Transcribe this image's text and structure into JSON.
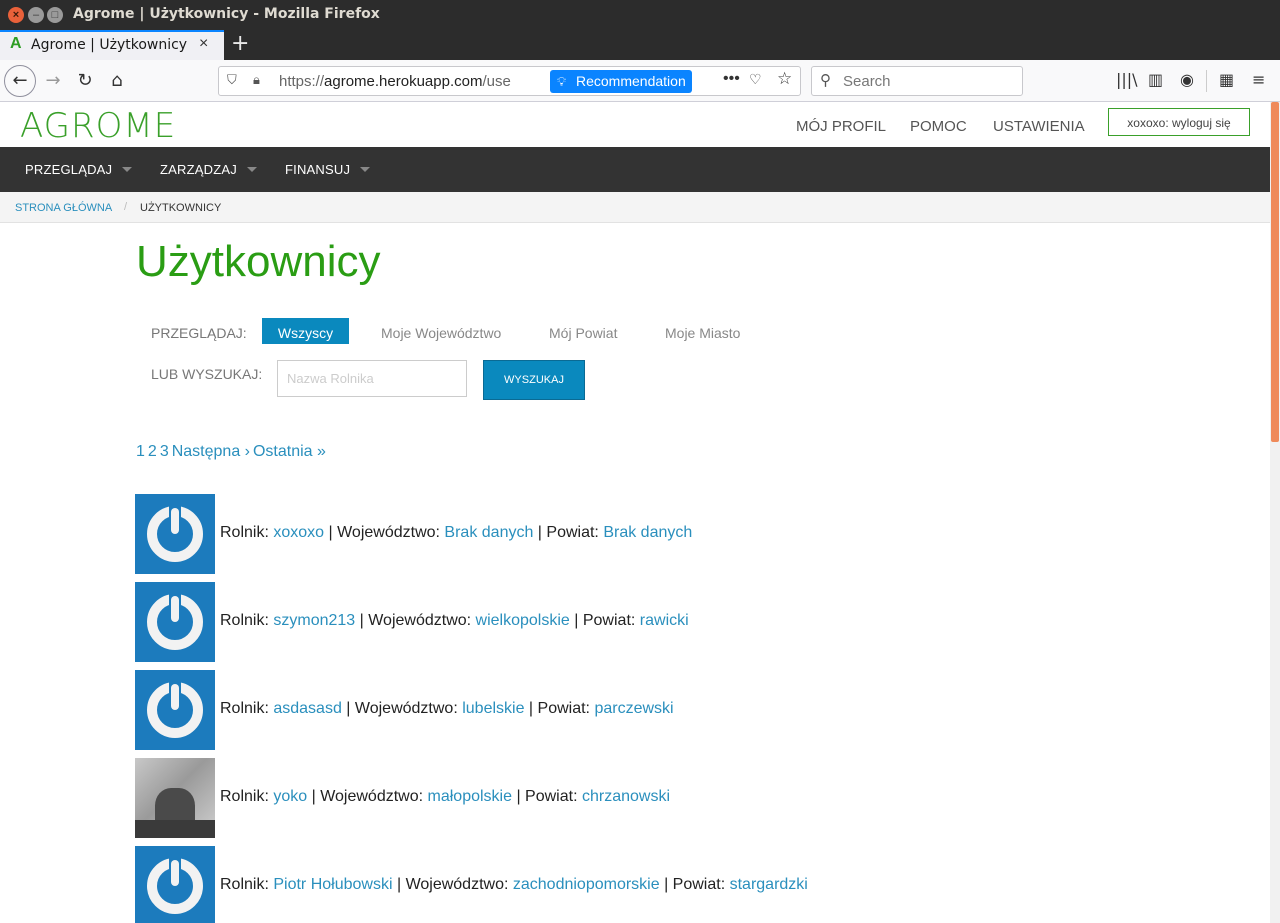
{
  "window": {
    "title": "Agrome | Użytkownicy - Mozilla Firefox",
    "controls": {
      "close": "×",
      "minimize": "–",
      "maximize": "□"
    }
  },
  "tab": {
    "favicon": "A",
    "title": "Agrome | Użytkownicy",
    "close": "×",
    "new_tab": "+"
  },
  "navbar": {
    "back": "←",
    "forward": "→",
    "reload": "↻",
    "home": "⌂",
    "url_prefix": "https://",
    "url_host": "agrome.herokuapp.com",
    "url_path": "/use",
    "recommendation": "Recommendation",
    "page_actions": "•••",
    "pocket": "♡",
    "bookmark_star": "☆",
    "search_placeholder": "Search",
    "library": "|||\\",
    "sidebar": "▥",
    "account": "◉",
    "extensions": "▦",
    "menu": "≡"
  },
  "site": {
    "logo": "AGROME",
    "top_links": {
      "profile": "MÓJ PROFIL",
      "help": "POMOC",
      "settings": "USTAWIENIA",
      "logout": "xoxoxo: wyloguj się"
    },
    "main_nav": [
      "PRZEGLĄDAJ",
      "ZARZĄDZAJ",
      "FINANSUJ"
    ],
    "breadcrumbs": {
      "home": "STRONA GŁÓWNA",
      "separator": "/",
      "current": "UŻYTKOWNICY"
    },
    "page_title": "Użytkownicy",
    "filter": {
      "label": "PRZEGLĄDAJ:",
      "tabs": [
        "Wszyscy",
        "Moje Województwo",
        "Mój Powiat",
        "Moje Miasto"
      ],
      "active_index": 0
    },
    "search": {
      "label": "LUB WYSZUKAJ:",
      "placeholder": "Nazwa Rolnika",
      "button": "WYSZUKAJ"
    },
    "pagination": [
      "1",
      "2",
      "3",
      "Następna ›",
      "Ostatnia »"
    ],
    "row_labels": {
      "farmer": "Rolnik: ",
      "voivodeship": " | Województwo: ",
      "county": " | Powiat: "
    },
    "users": [
      {
        "name": "xoxoxo",
        "voivodeship": "Brak danych",
        "county": "Brak danych",
        "avatar": "power-icon"
      },
      {
        "name": "szymon213",
        "voivodeship": "wielkopolskie",
        "county": "rawicki",
        "avatar": "power-icon"
      },
      {
        "name": "asdasasd",
        "voivodeship": "lubelskie",
        "county": "parczewski",
        "avatar": "power-icon"
      },
      {
        "name": "yoko",
        "voivodeship": "małopolskie",
        "county": "chrzanowski",
        "avatar": "photo"
      },
      {
        "name": "Piotr Hołubowski",
        "voivodeship": "zachodniopomorskie",
        "county": "stargardzki",
        "avatar": "power-icon"
      }
    ]
  },
  "colors": {
    "brand_green": "#2a9d14",
    "link_blue": "#2a8fbd",
    "button_blue": "#0a89be",
    "nav_dark": "#333333",
    "avatar_blue": "#1c7bbd"
  }
}
